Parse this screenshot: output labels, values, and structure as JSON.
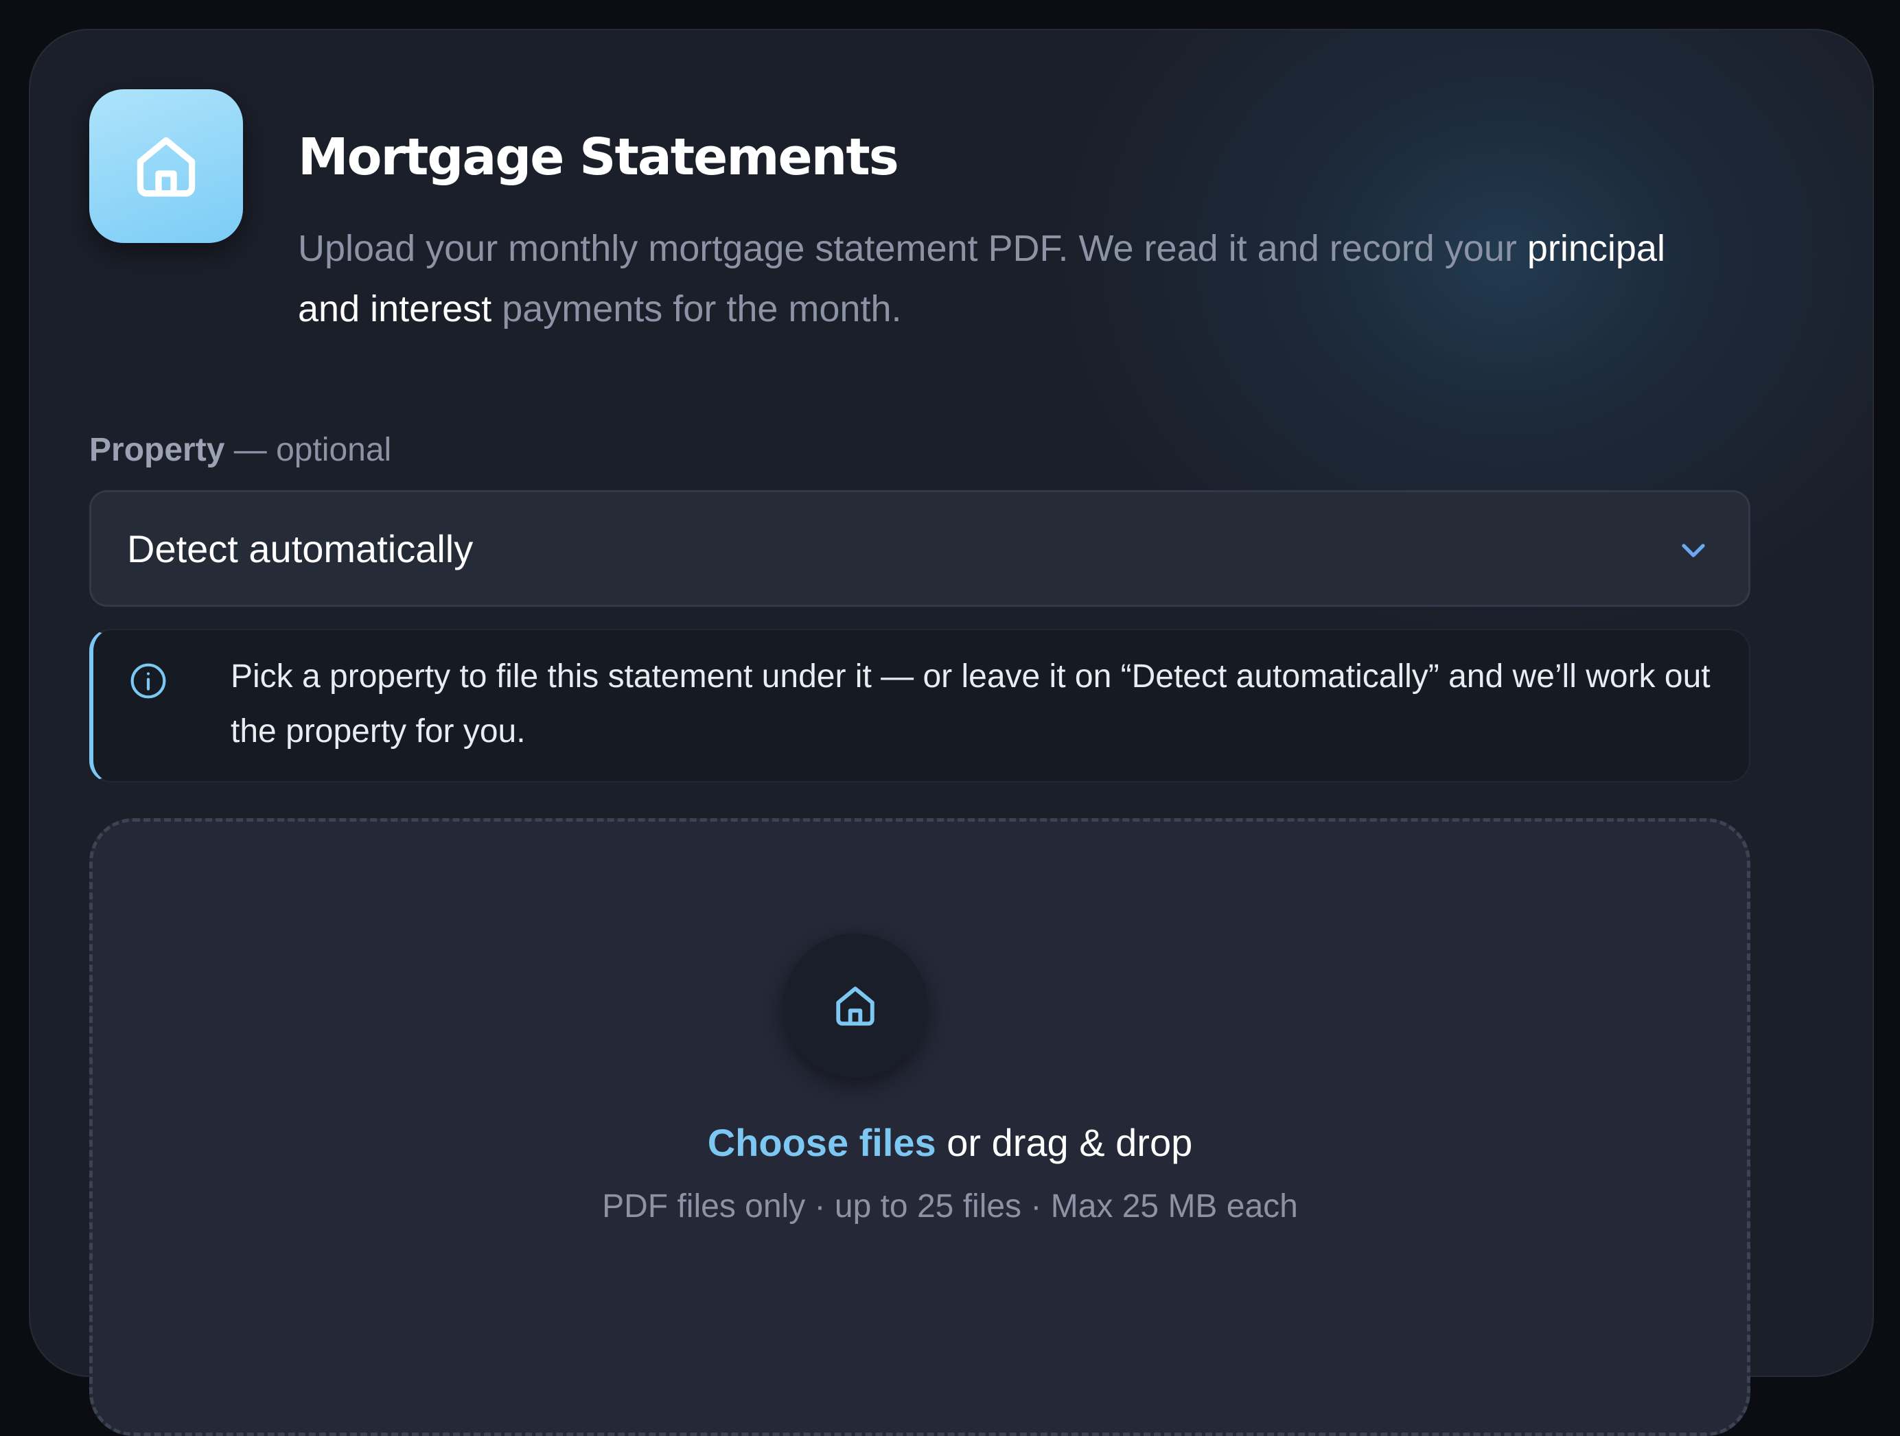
{
  "header": {
    "title": "Mortgage Statements",
    "description_pre": "Upload your monthly mortgage statement PDF. We read it and record your ",
    "description_emphasis": "principal and interest",
    "description_post": " payments for the month.",
    "icon": "house-icon"
  },
  "property_field": {
    "label": "Property",
    "label_suffix": " — optional",
    "selected_value": "Detect automatically",
    "dropdown_icon": "chevron-down-icon"
  },
  "info_note": {
    "icon": "info-icon",
    "text": "Pick a property to file this statement under it — or leave it on “Detect automatically” and we’ll work out the property for you."
  },
  "dropzone": {
    "icon": "house-icon",
    "link_label": "Choose files",
    "rest_label": " or drag & drop",
    "hint": "PDF files only · up to 25 files · Max 25 MB each"
  },
  "colors": {
    "accent": "#7cc8f2",
    "background": "#0b0d12",
    "card": "#1b1f2a"
  }
}
